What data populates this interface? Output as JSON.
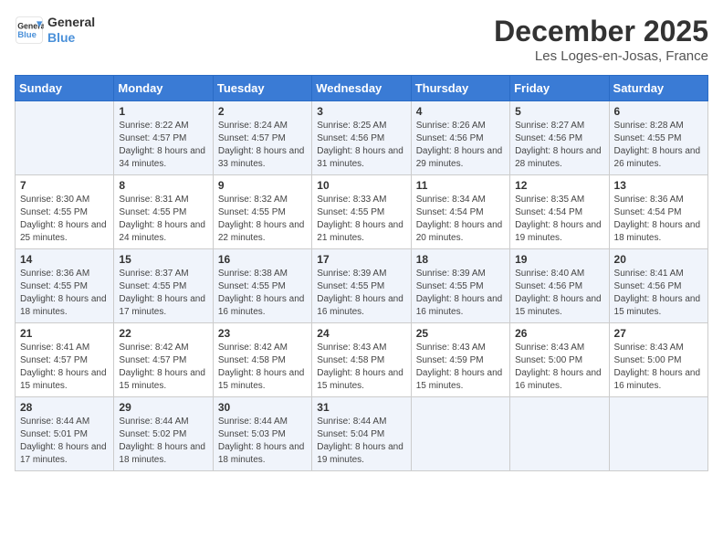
{
  "logo": {
    "line1": "General",
    "line2": "Blue"
  },
  "title": "December 2025",
  "location": "Les Loges-en-Josas, France",
  "header": {
    "days": [
      "Sunday",
      "Monday",
      "Tuesday",
      "Wednesday",
      "Thursday",
      "Friday",
      "Saturday"
    ]
  },
  "weeks": [
    [
      {
        "day": "",
        "sunrise": "",
        "sunset": "",
        "daylight": ""
      },
      {
        "day": "1",
        "sunrise": "Sunrise: 8:22 AM",
        "sunset": "Sunset: 4:57 PM",
        "daylight": "Daylight: 8 hours and 34 minutes."
      },
      {
        "day": "2",
        "sunrise": "Sunrise: 8:24 AM",
        "sunset": "Sunset: 4:57 PM",
        "daylight": "Daylight: 8 hours and 33 minutes."
      },
      {
        "day": "3",
        "sunrise": "Sunrise: 8:25 AM",
        "sunset": "Sunset: 4:56 PM",
        "daylight": "Daylight: 8 hours and 31 minutes."
      },
      {
        "day": "4",
        "sunrise": "Sunrise: 8:26 AM",
        "sunset": "Sunset: 4:56 PM",
        "daylight": "Daylight: 8 hours and 29 minutes."
      },
      {
        "day": "5",
        "sunrise": "Sunrise: 8:27 AM",
        "sunset": "Sunset: 4:56 PM",
        "daylight": "Daylight: 8 hours and 28 minutes."
      },
      {
        "day": "6",
        "sunrise": "Sunrise: 8:28 AM",
        "sunset": "Sunset: 4:55 PM",
        "daylight": "Daylight: 8 hours and 26 minutes."
      }
    ],
    [
      {
        "day": "7",
        "sunrise": "Sunrise: 8:30 AM",
        "sunset": "Sunset: 4:55 PM",
        "daylight": "Daylight: 8 hours and 25 minutes."
      },
      {
        "day": "8",
        "sunrise": "Sunrise: 8:31 AM",
        "sunset": "Sunset: 4:55 PM",
        "daylight": "Daylight: 8 hours and 24 minutes."
      },
      {
        "day": "9",
        "sunrise": "Sunrise: 8:32 AM",
        "sunset": "Sunset: 4:55 PM",
        "daylight": "Daylight: 8 hours and 22 minutes."
      },
      {
        "day": "10",
        "sunrise": "Sunrise: 8:33 AM",
        "sunset": "Sunset: 4:55 PM",
        "daylight": "Daylight: 8 hours and 21 minutes."
      },
      {
        "day": "11",
        "sunrise": "Sunrise: 8:34 AM",
        "sunset": "Sunset: 4:54 PM",
        "daylight": "Daylight: 8 hours and 20 minutes."
      },
      {
        "day": "12",
        "sunrise": "Sunrise: 8:35 AM",
        "sunset": "Sunset: 4:54 PM",
        "daylight": "Daylight: 8 hours and 19 minutes."
      },
      {
        "day": "13",
        "sunrise": "Sunrise: 8:36 AM",
        "sunset": "Sunset: 4:54 PM",
        "daylight": "Daylight: 8 hours and 18 minutes."
      }
    ],
    [
      {
        "day": "14",
        "sunrise": "Sunrise: 8:36 AM",
        "sunset": "Sunset: 4:55 PM",
        "daylight": "Daylight: 8 hours and 18 minutes."
      },
      {
        "day": "15",
        "sunrise": "Sunrise: 8:37 AM",
        "sunset": "Sunset: 4:55 PM",
        "daylight": "Daylight: 8 hours and 17 minutes."
      },
      {
        "day": "16",
        "sunrise": "Sunrise: 8:38 AM",
        "sunset": "Sunset: 4:55 PM",
        "daylight": "Daylight: 8 hours and 16 minutes."
      },
      {
        "day": "17",
        "sunrise": "Sunrise: 8:39 AM",
        "sunset": "Sunset: 4:55 PM",
        "daylight": "Daylight: 8 hours and 16 minutes."
      },
      {
        "day": "18",
        "sunrise": "Sunrise: 8:39 AM",
        "sunset": "Sunset: 4:55 PM",
        "daylight": "Daylight: 8 hours and 16 minutes."
      },
      {
        "day": "19",
        "sunrise": "Sunrise: 8:40 AM",
        "sunset": "Sunset: 4:56 PM",
        "daylight": "Daylight: 8 hours and 15 minutes."
      },
      {
        "day": "20",
        "sunrise": "Sunrise: 8:41 AM",
        "sunset": "Sunset: 4:56 PM",
        "daylight": "Daylight: 8 hours and 15 minutes."
      }
    ],
    [
      {
        "day": "21",
        "sunrise": "Sunrise: 8:41 AM",
        "sunset": "Sunset: 4:57 PM",
        "daylight": "Daylight: 8 hours and 15 minutes."
      },
      {
        "day": "22",
        "sunrise": "Sunrise: 8:42 AM",
        "sunset": "Sunset: 4:57 PM",
        "daylight": "Daylight: 8 hours and 15 minutes."
      },
      {
        "day": "23",
        "sunrise": "Sunrise: 8:42 AM",
        "sunset": "Sunset: 4:58 PM",
        "daylight": "Daylight: 8 hours and 15 minutes."
      },
      {
        "day": "24",
        "sunrise": "Sunrise: 8:43 AM",
        "sunset": "Sunset: 4:58 PM",
        "daylight": "Daylight: 8 hours and 15 minutes."
      },
      {
        "day": "25",
        "sunrise": "Sunrise: 8:43 AM",
        "sunset": "Sunset: 4:59 PM",
        "daylight": "Daylight: 8 hours and 15 minutes."
      },
      {
        "day": "26",
        "sunrise": "Sunrise: 8:43 AM",
        "sunset": "Sunset: 5:00 PM",
        "daylight": "Daylight: 8 hours and 16 minutes."
      },
      {
        "day": "27",
        "sunrise": "Sunrise: 8:43 AM",
        "sunset": "Sunset: 5:00 PM",
        "daylight": "Daylight: 8 hours and 16 minutes."
      }
    ],
    [
      {
        "day": "28",
        "sunrise": "Sunrise: 8:44 AM",
        "sunset": "Sunset: 5:01 PM",
        "daylight": "Daylight: 8 hours and 17 minutes."
      },
      {
        "day": "29",
        "sunrise": "Sunrise: 8:44 AM",
        "sunset": "Sunset: 5:02 PM",
        "daylight": "Daylight: 8 hours and 18 minutes."
      },
      {
        "day": "30",
        "sunrise": "Sunrise: 8:44 AM",
        "sunset": "Sunset: 5:03 PM",
        "daylight": "Daylight: 8 hours and 18 minutes."
      },
      {
        "day": "31",
        "sunrise": "Sunrise: 8:44 AM",
        "sunset": "Sunset: 5:04 PM",
        "daylight": "Daylight: 8 hours and 19 minutes."
      },
      {
        "day": "",
        "sunrise": "",
        "sunset": "",
        "daylight": ""
      },
      {
        "day": "",
        "sunrise": "",
        "sunset": "",
        "daylight": ""
      },
      {
        "day": "",
        "sunrise": "",
        "sunset": "",
        "daylight": ""
      }
    ]
  ]
}
